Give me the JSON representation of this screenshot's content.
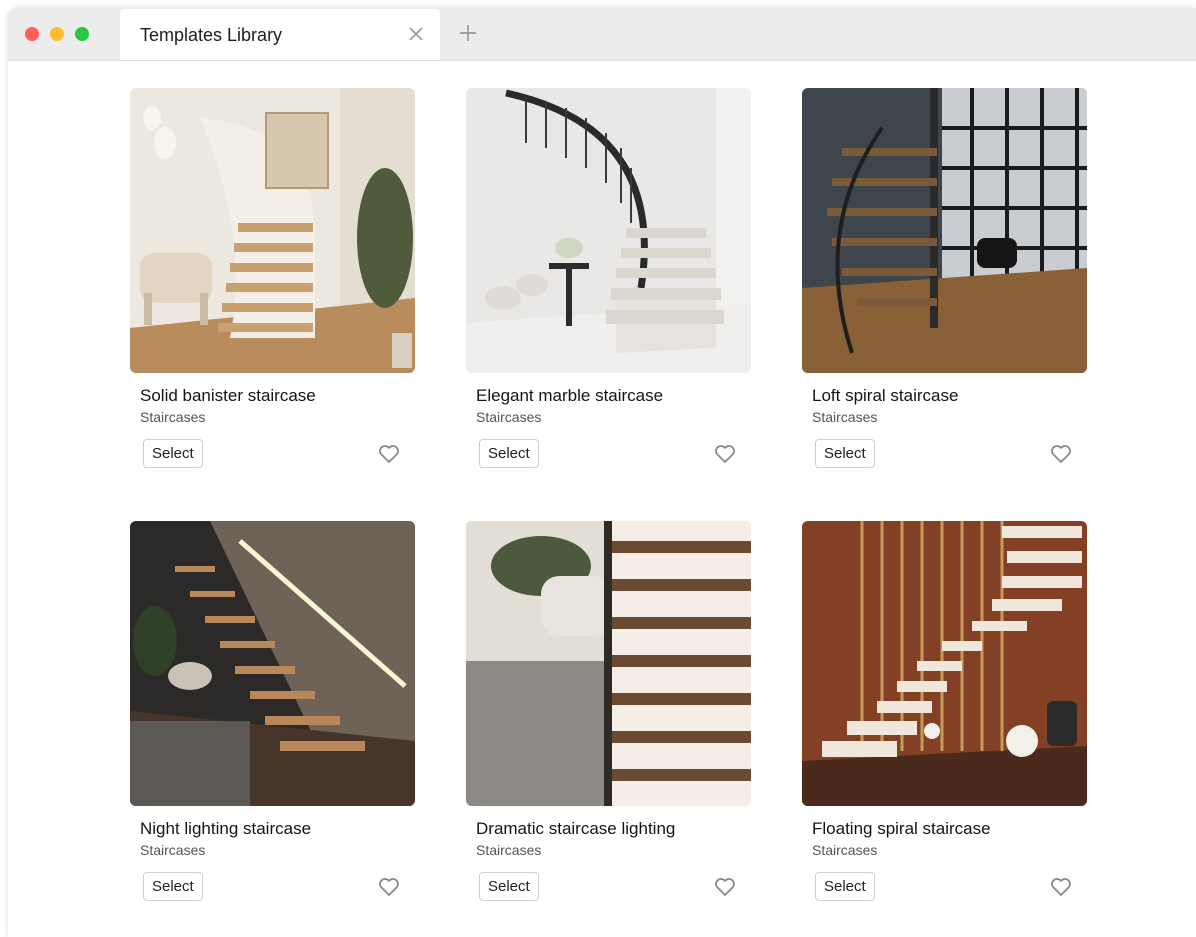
{
  "window": {
    "tab_title": "Templates Library"
  },
  "cards": [
    {
      "title": "Solid banister staircase",
      "category": "Staircases",
      "select_label": "Select"
    },
    {
      "title": "Elegant marble staircase",
      "category": "Staircases",
      "select_label": "Select"
    },
    {
      "title": "Loft spiral staircase",
      "category": "Staircases",
      "select_label": "Select"
    },
    {
      "title": "Night lighting staircase",
      "category": "Staircases",
      "select_label": "Select"
    },
    {
      "title": "Dramatic staircase lighting",
      "category": "Staircases",
      "select_label": "Select"
    },
    {
      "title": "Floating spiral staircase",
      "category": "Staircases",
      "select_label": "Select"
    }
  ],
  "colors": {
    "close_dot": "#ff5f57",
    "minimize_dot": "#febc2e",
    "zoom_dot": "#28c840"
  },
  "icons": [
    "close-icon",
    "plus-icon",
    "heart-icon"
  ]
}
